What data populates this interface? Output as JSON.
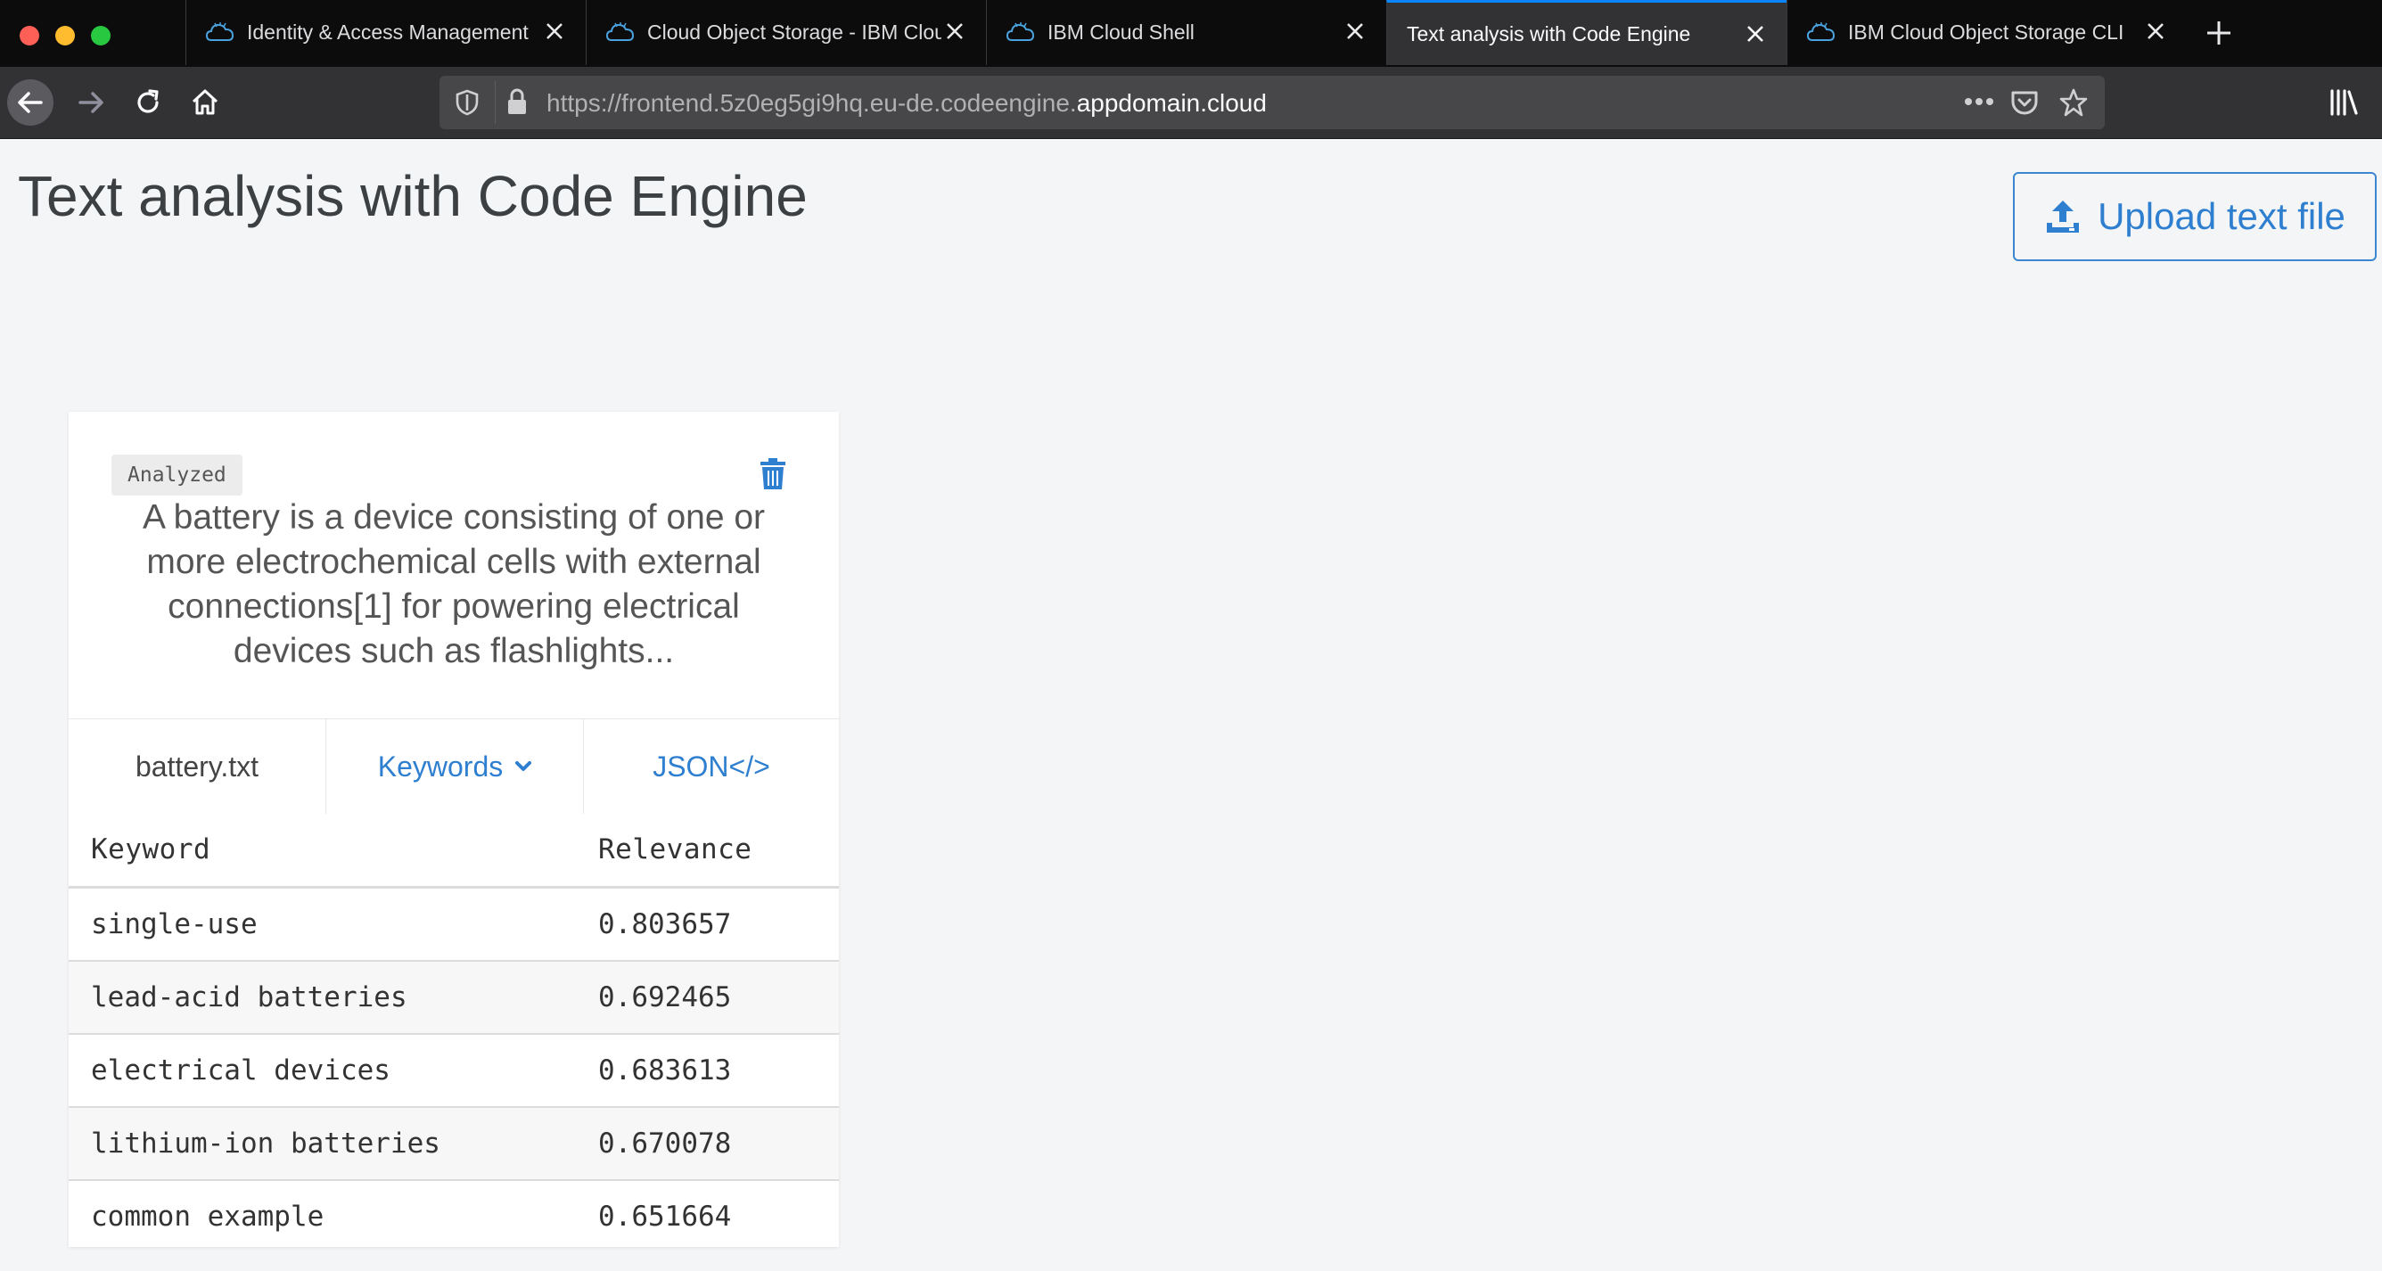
{
  "browser": {
    "tabs": [
      {
        "title": "Identity & Access Management",
        "active": false
      },
      {
        "title": "Cloud Object Storage - IBM Cloud",
        "active": false
      },
      {
        "title": "IBM Cloud Shell",
        "active": false
      },
      {
        "title": "Text analysis with Code Engine",
        "active": true
      },
      {
        "title": "IBM Cloud Object Storage CLI",
        "active": false
      }
    ],
    "url_prefix": "https://frontend.5z0eg5gi9hq.eu-de.codeengine.",
    "url_domain": "appdomain.cloud",
    "accent": "#0a84ff"
  },
  "page": {
    "title": "Text analysis with Code Engine",
    "upload_label": "Upload text file"
  },
  "card": {
    "status": "Analyzed",
    "snippet": "A battery is a device consisting of one or more electrochemical cells with external connections[1] for powering electrical devices such as flashlights...",
    "filename": "battery.txt",
    "view_label": "Keywords",
    "json_label": "JSON</>",
    "table": {
      "headers": [
        "Keyword",
        "Relevance"
      ],
      "rows": [
        {
          "keyword": "single-use",
          "relevance": "0.803657"
        },
        {
          "keyword": "lead-acid batteries",
          "relevance": "0.692465"
        },
        {
          "keyword": "electrical devices",
          "relevance": "0.683613"
        },
        {
          "keyword": "lithium-ion batteries",
          "relevance": "0.670078"
        },
        {
          "keyword": "common example",
          "relevance": "0.651664"
        }
      ]
    }
  },
  "colors": {
    "link_blue": "#2f7fd0",
    "page_bg": "#f4f5f7"
  },
  "icons": [
    "close-icon",
    "new-tab-icon",
    "back-arrow-icon",
    "forward-arrow-icon",
    "reload-icon",
    "home-icon",
    "shield-icon",
    "lock-icon",
    "more-icon",
    "pocket-icon",
    "bookmark-star-icon",
    "library-icon",
    "ibm-cloud-icon",
    "upload-icon",
    "trash-icon",
    "chevron-down-icon"
  ]
}
